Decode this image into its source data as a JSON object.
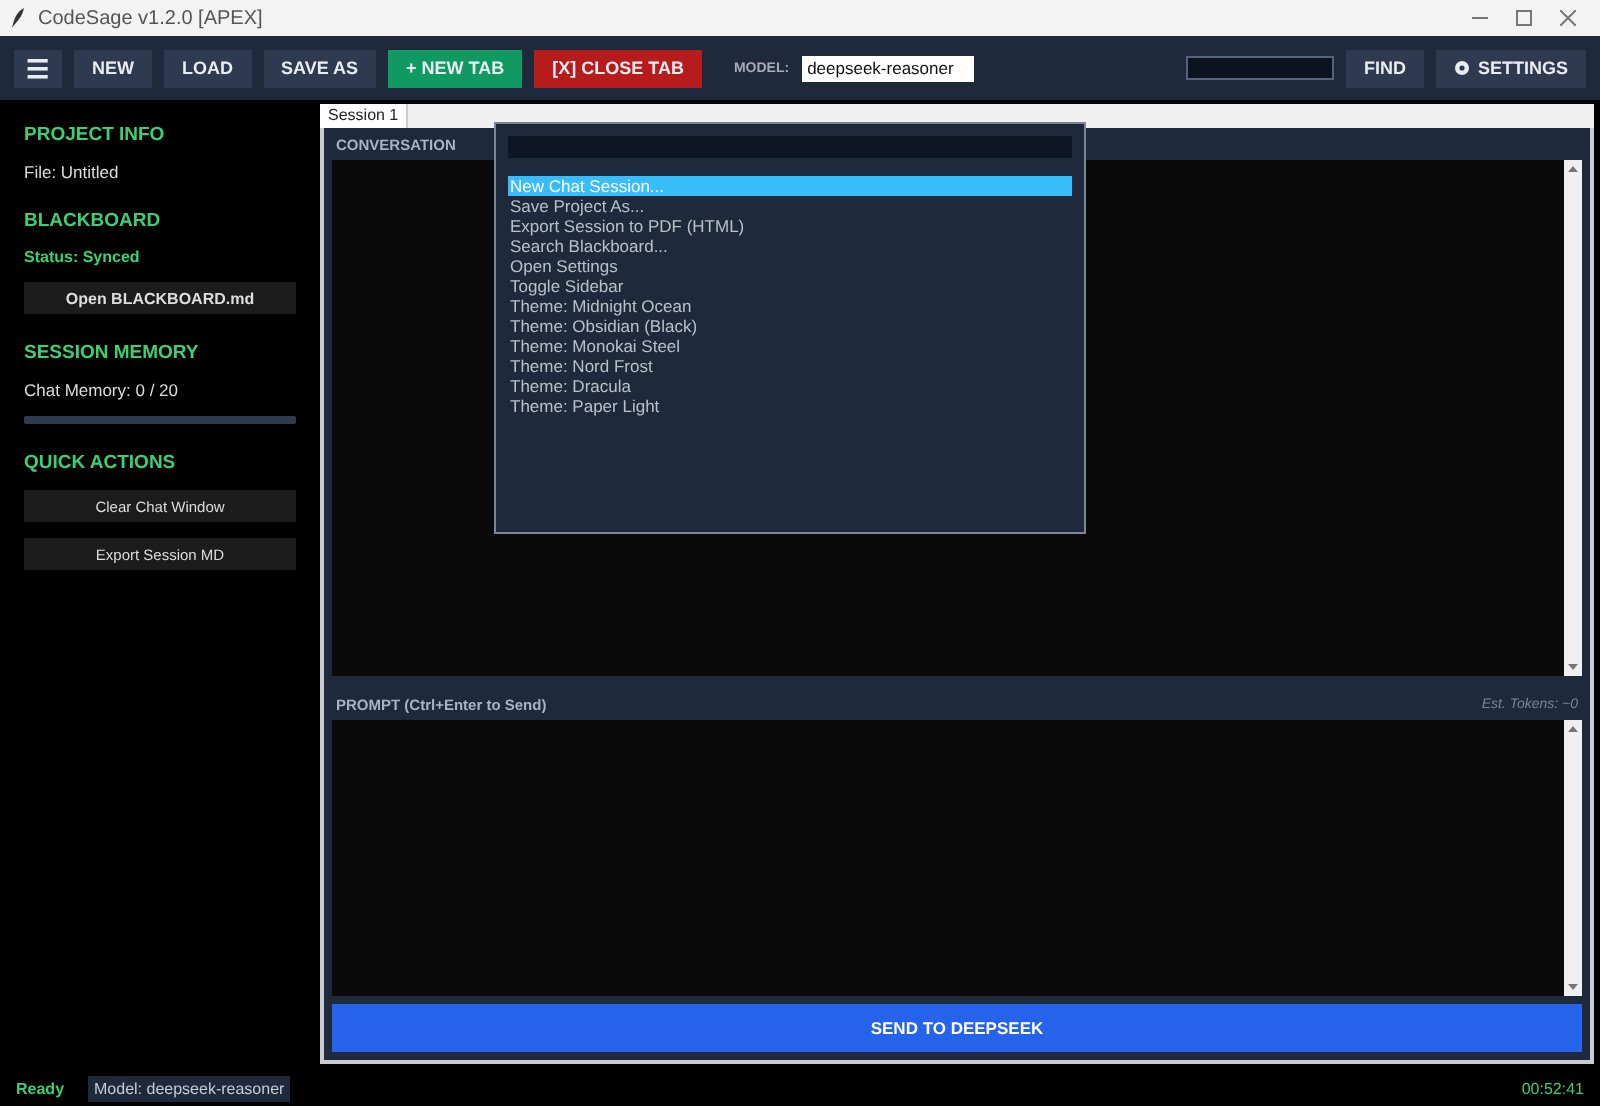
{
  "window": {
    "title": "CodeSage v1.2.0 [APEX]"
  },
  "toolbar": {
    "menu_label": "☰",
    "buttons": [
      {
        "label": "NEW",
        "kind": "plain"
      },
      {
        "label": "LOAD",
        "kind": "plain"
      },
      {
        "label": "SAVE AS",
        "kind": "plain"
      },
      {
        "label": "+ NEW TAB",
        "kind": "success"
      },
      {
        "label": "[X] CLOSE TAB",
        "kind": "danger"
      }
    ],
    "model_label": "MODEL:",
    "model_value": "deepseek-reasoner",
    "find_label": "FIND",
    "settings_label": "SETTINGS"
  },
  "sidebar": {
    "sections": [
      {
        "heading": "PROJECT INFO",
        "items": [
          {
            "kind": "text",
            "text": "File: Untitled"
          }
        ]
      },
      {
        "heading": "BLACKBOARD",
        "items": [
          {
            "kind": "status",
            "text": "Status: Synced"
          },
          {
            "kind": "button",
            "text": "Open BLACKBOARD.md"
          }
        ]
      },
      {
        "heading": "SESSION MEMORY",
        "items": [
          {
            "kind": "text",
            "text": "Chat Memory: 0 / 20"
          },
          {
            "kind": "meter",
            "level": 0
          }
        ]
      },
      {
        "heading": "QUICK ACTIONS",
        "items": [
          {
            "kind": "plain-button",
            "text": "Clear Chat Window"
          },
          {
            "kind": "plain-button",
            "text": "Export Session MD"
          }
        ]
      }
    ]
  },
  "tabs": [
    {
      "label": "Session 1",
      "selected": true
    }
  ],
  "conversation": {
    "heading": "CONVERSATION"
  },
  "prompt": {
    "heading": "PROMPT (Ctrl+Enter to Send)",
    "tokens": "Est. Tokens: ~0",
    "send_label": "SEND TO DEEPSEEK"
  },
  "command_palette": {
    "items": [
      {
        "label": "New Chat Session...",
        "selected": true
      },
      {
        "label": "Save Project As...",
        "selected": false
      },
      {
        "label": "Export Session to PDF (HTML)",
        "selected": false
      },
      {
        "label": "Search Blackboard...",
        "selected": false
      },
      {
        "label": "Open Settings",
        "selected": false
      },
      {
        "label": "Toggle Sidebar",
        "selected": false
      },
      {
        "label": "Theme: Midnight Ocean",
        "selected": false
      },
      {
        "label": "Theme: Obsidian (Black)",
        "selected": false
      },
      {
        "label": "Theme: Monokai Steel",
        "selected": false
      },
      {
        "label": "Theme: Nord Frost",
        "selected": false
      },
      {
        "label": "Theme: Dracula",
        "selected": false
      },
      {
        "label": "Theme: Paper Light",
        "selected": false
      }
    ]
  },
  "status_bar": {
    "status": "Ready",
    "model": "Model: deepseek-reasoner",
    "time": "00:52:41"
  }
}
